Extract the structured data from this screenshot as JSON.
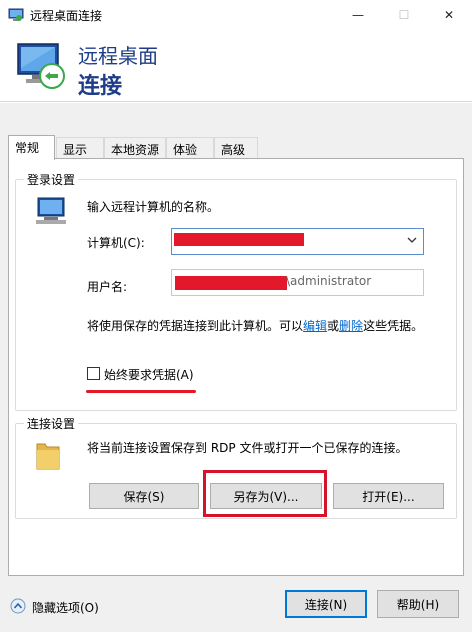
{
  "window": {
    "title": "远程桌面连接",
    "minimize_glyph": "—",
    "maximize_glyph": "☐",
    "close_glyph": "✕"
  },
  "banner": {
    "line1": "远程桌面",
    "line2": "连接"
  },
  "tabs": [
    {
      "label": "常规",
      "active": true
    },
    {
      "label": "显示",
      "active": false
    },
    {
      "label": "本地资源",
      "active": false
    },
    {
      "label": "体验",
      "active": false
    },
    {
      "label": "高级",
      "active": false
    }
  ],
  "logon": {
    "legend": "登录设置",
    "instruction": "输入远程计算机的名称。",
    "computer_label": "计算机(C):",
    "computer_value": "",
    "user_label": "用户名:",
    "user_value_suffix": "\\administrator",
    "saved_text_prefix": "将使用保存的凭据连接到此计算机。可以",
    "edit_link": "编辑",
    "or_text": "或",
    "delete_link": "删除",
    "saved_text_suffix": "这些凭据。",
    "always_ask_label": "始终要求凭据(A)",
    "always_ask_checked": false
  },
  "connection": {
    "legend": "连接设置",
    "description": "将当前连接设置保存到 RDP 文件或打开一个已保存的连接。",
    "save_button": "保存(S)",
    "save_as_button": "另存为(V)...",
    "open_button": "打开(E)..."
  },
  "footer": {
    "hide_options": "隐藏选项(O)",
    "connect_button": "连接(N)",
    "help_button": "帮助(H)"
  },
  "colors": {
    "accent": "#0078d7",
    "banner_text": "#1f3c88",
    "annotation_red": "#e3182b",
    "link": "#0066cc"
  },
  "icons": [
    "remote-desktop-icon",
    "computer-icon",
    "folder-icon",
    "chevron-down-icon",
    "collapse-up-icon"
  ]
}
